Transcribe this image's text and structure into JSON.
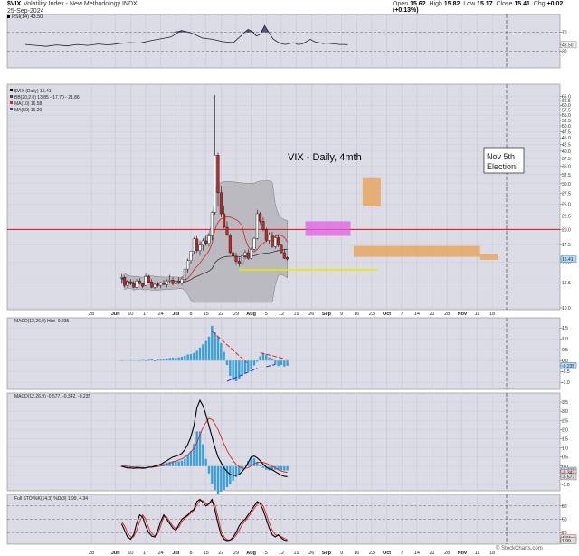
{
  "header": {
    "symbol": "$VIX",
    "description": "Volatility Index - New Methodology INDX",
    "date": "25-Sep-2024",
    "open_label": "Open",
    "open": "15.62",
    "high_label": "High",
    "high": "15.82",
    "low_label": "Low",
    "low": "15.17",
    "close_label": "Close",
    "close": "15.41",
    "chg_label": "Chg",
    "chg": "+0.02 (+0.13%)"
  },
  "watermark": "© StockCharts.com",
  "colors": {
    "panel_bg": "#dcdce6",
    "band": "#b4b4b8",
    "red": "#dd2222",
    "blue": "#3aa0d8",
    "yellow": "#e8e800",
    "orange": "#e8a050",
    "magenta": "#e060e0"
  },
  "chart_data": [
    {
      "type": "line",
      "panel": "RSI",
      "legend": "RSI(14) 43.50",
      "value_label": "43.50",
      "y_ticks": [
        "70",
        "30"
      ],
      "ylim": [
        0,
        100
      ],
      "levels": [
        70,
        30
      ],
      "x": [
        0,
        5,
        10,
        15,
        20,
        25,
        30,
        35,
        40,
        45,
        50,
        55,
        60,
        65,
        70,
        75,
        80,
        85,
        90,
        95,
        100
      ],
      "values": [
        44,
        42,
        40,
        43,
        41,
        44,
        42,
        45,
        43,
        46,
        48,
        47,
        52,
        56,
        60,
        74,
        68,
        58,
        55,
        50,
        48
      ],
      "x2": [
        101,
        103,
        105,
        107,
        109,
        111,
        113,
        115,
        117,
        119,
        121,
        123,
        125,
        127,
        129,
        131,
        133,
        135,
        137,
        139,
        141,
        143,
        145,
        147,
        149,
        151,
        153,
        155
      ],
      "values2": [
        52,
        60,
        68,
        76,
        72,
        62,
        66,
        84,
        70,
        56,
        50,
        46,
        44,
        46,
        48,
        44,
        45,
        50,
        55,
        50,
        48,
        46,
        47,
        46,
        45,
        44,
        44,
        43.5
      ]
    },
    {
      "type": "candlestick",
      "panel": "Price",
      "title": "VIX - Daily, 4mth",
      "annotation": "Nov 5th\nElection!",
      "legend": [
        "$VIX (Daily) 15.41",
        "BB(20,2.0) 13.85 - 17.70 - 21.86",
        "MA(10) 16.58",
        "MA(50) 16.20"
      ],
      "scale": "log",
      "ylim": [
        10,
        70
      ],
      "y_ticks": [
        65.0,
        62.5,
        60.0,
        57.5,
        55.0,
        52.5,
        50.0,
        47.5,
        45.0,
        42.5,
        40.0,
        37.5,
        35.0,
        32.5,
        30.0,
        27.5,
        25.0,
        22.5,
        20.0,
        17.5,
        15.0,
        12.5,
        10.0
      ],
      "last_label": "15.41",
      "hline": 20.0,
      "candles": [
        [
          13.0,
          13.5,
          12.4,
          13.1
        ],
        [
          13.1,
          13.3,
          12.0,
          12.2
        ],
        [
          12.2,
          12.8,
          11.9,
          12.6
        ],
        [
          12.6,
          12.9,
          12.2,
          12.4
        ],
        [
          12.4,
          12.7,
          11.9,
          12.0
        ],
        [
          12.0,
          12.9,
          11.9,
          12.7
        ],
        [
          12.7,
          13.0,
          12.3,
          12.4
        ],
        [
          12.4,
          12.5,
          11.9,
          12.1
        ],
        [
          12.2,
          13.6,
          12.1,
          13.2
        ],
        [
          13.2,
          13.4,
          12.5,
          12.6
        ],
        [
          12.6,
          12.9,
          11.9,
          12.0
        ],
        [
          12.0,
          12.5,
          11.8,
          12.3
        ],
        [
          12.3,
          12.6,
          12.0,
          12.2
        ],
        [
          12.2,
          12.6,
          11.9,
          12.5
        ],
        [
          12.5,
          12.8,
          12.2,
          12.3
        ],
        [
          12.3,
          12.9,
          12.0,
          12.7
        ],
        [
          12.7,
          13.4,
          12.4,
          12.8
        ],
        [
          12.8,
          13.1,
          12.2,
          12.4
        ],
        [
          12.4,
          12.9,
          12.1,
          12.7
        ],
        [
          12.7,
          13.1,
          12.3,
          12.5
        ],
        [
          12.5,
          13.2,
          12.2,
          12.9
        ],
        [
          12.9,
          14.3,
          12.8,
          14.1
        ],
        [
          14.1,
          15.5,
          13.6,
          15.2
        ],
        [
          15.2,
          16.6,
          14.8,
          16.5
        ],
        [
          16.5,
          18.7,
          16.1,
          18.4
        ],
        [
          18.4,
          18.9,
          16.3,
          16.6
        ],
        [
          16.6,
          18.1,
          15.9,
          17.4
        ],
        [
          17.4,
          18.5,
          16.6,
          18.1
        ],
        [
          18.1,
          18.9,
          17.3,
          17.7
        ],
        [
          17.7,
          19.4,
          17.2,
          18.9
        ],
        [
          18.9,
          23.5,
          18.2,
          23.3
        ],
        [
          23.3,
          65.7,
          22.8,
          38.6
        ],
        [
          38.6,
          39.5,
          24.5,
          27.7
        ],
        [
          27.7,
          29.5,
          22.3,
          23.0
        ],
        [
          23.0,
          24.7,
          20.2,
          20.4
        ],
        [
          20.4,
          21.5,
          18.9,
          19.0
        ],
        [
          19.0,
          19.3,
          16.1,
          16.3
        ],
        [
          16.3,
          17.0,
          15.5,
          15.8
        ],
        [
          15.8,
          16.3,
          14.6,
          15.1
        ],
        [
          15.1,
          15.6,
          14.4,
          14.8
        ],
        [
          14.8,
          16.2,
          14.5,
          15.9
        ],
        [
          15.9,
          16.7,
          15.4,
          16.3
        ],
        [
          16.3,
          16.8,
          15.3,
          15.5
        ],
        [
          15.5,
          17.0,
          15.4,
          16.8
        ],
        [
          16.8,
          18.7,
          16.6,
          18.5
        ],
        [
          18.5,
          23.8,
          18.3,
          23.0
        ],
        [
          23.0,
          23.4,
          21.0,
          21.5
        ],
        [
          21.5,
          22.2,
          19.7,
          20.0
        ],
        [
          20.0,
          20.3,
          17.9,
          18.2
        ],
        [
          18.2,
          19.5,
          17.6,
          19.1
        ],
        [
          19.1,
          19.6,
          17.0,
          17.2
        ],
        [
          17.2,
          18.9,
          16.9,
          18.6
        ],
        [
          18.6,
          19.2,
          17.1,
          17.4
        ],
        [
          17.4,
          17.6,
          16.2,
          16.3
        ],
        [
          16.3,
          16.8,
          15.4,
          15.5
        ],
        [
          15.6,
          15.8,
          15.2,
          15.4
        ]
      ],
      "boxes": [
        {
          "label": "22.17",
          "x0": 92,
          "x1": 107,
          "y0": 18.9,
          "y1": 21.5,
          "color": "magenta"
        },
        {
          "label": "",
          "x0": 111,
          "x1": 117,
          "y0": 24.5,
          "y1": 31.5,
          "color": "orange"
        },
        {
          "label": "",
          "x0": 108,
          "x1": 150,
          "y0": 15.7,
          "y1": 17.3,
          "color": "orange"
        },
        {
          "label": "",
          "x0": 150,
          "x1": 156,
          "y0": 15.3,
          "y1": 16.1,
          "color": "orange"
        }
      ],
      "support_line": {
        "x0": 70,
        "x1": 116,
        "y": 14.0
      },
      "x_tick_labels": [
        "28",
        "Jun",
        "10",
        "17",
        "24",
        "Jul",
        "8",
        "15",
        "22",
        "29",
        "Aug",
        "5",
        "12",
        "19",
        "26",
        "Sep",
        "9",
        "16",
        "23",
        "Oct",
        "7",
        "14",
        "21",
        "28",
        "Nov",
        "11",
        "18"
      ]
    },
    {
      "type": "histogram",
      "panel": "MACD-Hist",
      "legend": "MACD(12,26,9) Hist -0.235",
      "y_ticks": [
        "1.5",
        "1.0",
        "0.5",
        "0.0",
        "-0.5",
        "-1.0"
      ],
      "ylim": [
        -1.2,
        1.8
      ],
      "value_label": "-0.235",
      "values": [
        -0.02,
        0.01,
        -0.01,
        0.02,
        -0.01,
        0.01,
        -0.02,
        0.03,
        -0.03,
        0.04,
        0.05,
        -0.04,
        0.05,
        0.04,
        0.06,
        0.1,
        0.12,
        0.14,
        0.12,
        0.15,
        0.18,
        0.22,
        0.28,
        0.3,
        0.35,
        0.45,
        0.6,
        0.75,
        0.9,
        1.1,
        1.6,
        1.3,
        1.1,
        0.8,
        0.4,
        -0.2,
        -0.7,
        -0.9,
        -0.95,
        -0.85,
        -0.7,
        -0.6,
        -0.5,
        -0.38,
        -0.22,
        -0.05,
        0.2,
        0.35,
        0.28,
        0.15,
        0.05,
        -0.18,
        -0.25,
        -0.2,
        -0.27,
        -0.235
      ]
    },
    {
      "type": "line",
      "panel": "MACD",
      "legend": "MACD(12,26,9) -0.577, -0.342, -0.235",
      "y_ticks": [
        "3.5",
        "3.0",
        "2.5",
        "2.0",
        "1.5",
        "1.0",
        "0.5",
        "0.0",
        "-0.5",
        "-1.0"
      ],
      "ylim": [
        -1.2,
        3.8
      ],
      "value_labels": [
        "-0.235",
        "-0.342",
        "-0.577"
      ],
      "macd": [
        0.0,
        -0.05,
        -0.1,
        -0.1,
        -0.12,
        -0.1,
        -0.1,
        -0.12,
        -0.1,
        -0.05,
        -0.05,
        0.0,
        0.05,
        0.1,
        0.2,
        0.3,
        0.4,
        0.5,
        0.55,
        0.6,
        0.7,
        0.9,
        1.2,
        1.6,
        2.2,
        3.2,
        3.6,
        3.3,
        2.8,
        2.2,
        1.6,
        1.0,
        0.5,
        0.2,
        -0.1,
        -0.3,
        -0.45,
        -0.5,
        -0.5,
        -0.45,
        -0.3,
        -0.1,
        0.2,
        0.5,
        0.55,
        0.45,
        0.3,
        0.1,
        -0.05,
        -0.15,
        -0.2,
        -0.3,
        -0.4,
        -0.5,
        -0.55,
        -0.577
      ],
      "signal": [
        0.05,
        0.03,
        0.0,
        -0.02,
        -0.05,
        -0.06,
        -0.07,
        -0.08,
        -0.08,
        -0.07,
        -0.06,
        -0.04,
        -0.02,
        0.01,
        0.05,
        0.1,
        0.16,
        0.22,
        0.28,
        0.34,
        0.4,
        0.5,
        0.62,
        0.78,
        0.98,
        1.3,
        1.7,
        2.1,
        2.4,
        2.6,
        2.55,
        2.3,
        2.0,
        1.6,
        1.2,
        0.85,
        0.55,
        0.3,
        0.1,
        -0.02,
        -0.1,
        -0.12,
        -0.08,
        0.02,
        0.12,
        0.2,
        0.22,
        0.2,
        0.15,
        0.08,
        0.0,
        -0.1,
        -0.2,
        -0.27,
        -0.31,
        -0.342
      ]
    },
    {
      "type": "line",
      "panel": "Stochastic",
      "legend": "Full STO %K(14,3) %D(3) 1.99, 4.34",
      "y_ticks": [
        "80",
        "50",
        "20"
      ],
      "ylim": [
        0,
        100
      ],
      "value_labels": [
        "4.34",
        "1.99"
      ],
      "k": [
        40,
        25,
        10,
        5,
        15,
        40,
        60,
        55,
        35,
        20,
        12,
        10,
        25,
        45,
        60,
        50,
        40,
        30,
        25,
        38,
        50,
        55,
        60,
        68,
        72,
        90,
        95,
        88,
        80,
        85,
        95,
        70,
        40,
        15,
        5,
        2,
        3,
        10,
        20,
        35,
        45,
        50,
        60,
        70,
        80,
        90,
        85,
        70,
        50,
        30,
        15,
        10,
        15,
        8,
        3,
        1.99
      ],
      "d": [
        45,
        35,
        20,
        10,
        10,
        25,
        45,
        60,
        50,
        30,
        18,
        12,
        18,
        35,
        55,
        55,
        45,
        35,
        28,
        32,
        45,
        52,
        58,
        64,
        70,
        82,
        92,
        92,
        85,
        84,
        90,
        82,
        55,
        25,
        10,
        4,
        3,
        6,
        14,
        25,
        38,
        46,
        55,
        64,
        74,
        84,
        88,
        80,
        62,
        42,
        25,
        15,
        13,
        11,
        7,
        4.34
      ]
    }
  ]
}
